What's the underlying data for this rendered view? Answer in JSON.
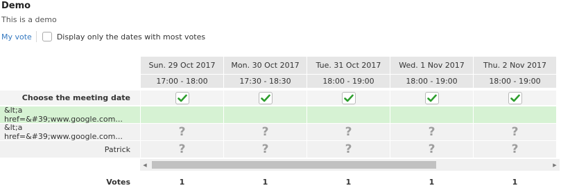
{
  "poll": {
    "title": "Demo",
    "description": "This is a demo"
  },
  "toolbar": {
    "my_vote_label": "My vote",
    "filter_label": "Display only the dates with most votes",
    "filter_checked": false
  },
  "columns": [
    {
      "date": "Sun. 29 Oct 2017",
      "time": "17:00 - 18:00",
      "votes": "1"
    },
    {
      "date": "Mon. 30 Oct 2017",
      "time": "17:30 - 18:30",
      "votes": "1"
    },
    {
      "date": "Tue. 31 Oct 2017",
      "time": "18:00 - 19:00",
      "votes": "1"
    },
    {
      "date": "Wed. 1 Nov 2017",
      "time": "18:00 - 19:00",
      "votes": "1"
    },
    {
      "date": "Thu. 2 Nov 2017",
      "time": "18:00 - 19:00",
      "votes": "1"
    }
  ],
  "rows": {
    "choose_label": "Choose the meeting date",
    "participants": [
      {
        "name": "&lt;a href=&#39;www.google.com...",
        "marks": [
          "",
          "",
          "",
          "",
          ""
        ]
      },
      {
        "name": "&lt;a href=&#39;www.google.com...",
        "marks": [
          "?",
          "?",
          "?",
          "?",
          "?"
        ]
      },
      {
        "name": "Patrick",
        "marks": [
          "?",
          "?",
          "?",
          "?",
          "?"
        ]
      }
    ]
  },
  "footer": {
    "votes_label": "Votes"
  },
  "colors": {
    "link": "#3478c0",
    "header_bg": "#e6e6e6",
    "highlight_row": "#d6f2d3",
    "check": "#2e9e2e"
  },
  "icons": {
    "choose": "checkmark-icon",
    "unknown": "question-mark-icon",
    "scroll_left": "triangle-left-icon",
    "scroll_right": "triangle-right-icon"
  }
}
